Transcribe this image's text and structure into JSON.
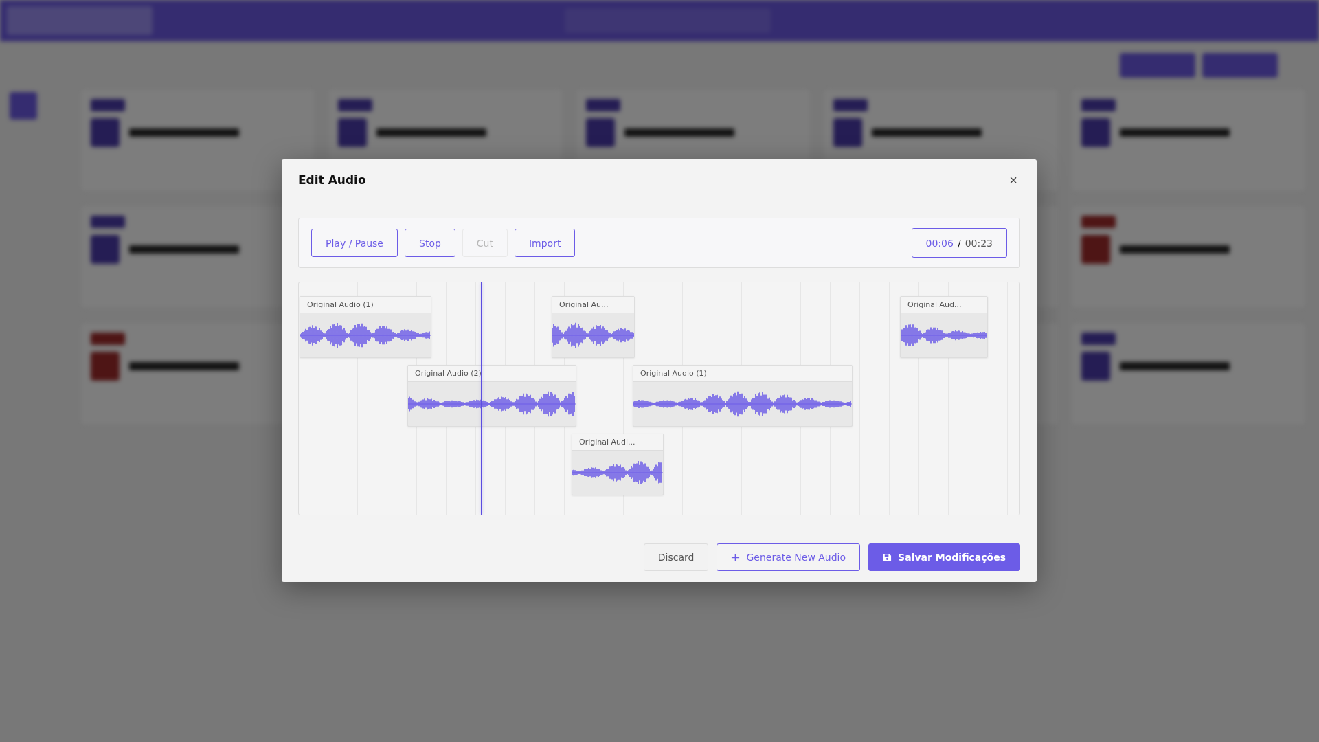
{
  "dialog": {
    "title": "Edit Audio",
    "close": "×",
    "toolbar": [
      {
        "label": "Play / Pause",
        "disabled": false
      },
      {
        "label": "Stop",
        "disabled": false
      },
      {
        "label": "Cut",
        "disabled": true
      },
      {
        "label": "Import",
        "disabled": false
      }
    ],
    "time": {
      "current": "00:06",
      "separator": "/",
      "total": "00:23"
    },
    "clips": [
      {
        "label": "Original Audio (1)"
      },
      {
        "label": "Original Au..."
      },
      {
        "label": "Original Aud..."
      },
      {
        "label": "Original Audio (2)"
      },
      {
        "label": "Original Audio (1)"
      },
      {
        "label": "Original Audi..."
      }
    ],
    "footer": [
      {
        "label": "Discard",
        "kind": "secondary"
      },
      {
        "label": "Generate New Audio",
        "kind": "outline"
      },
      {
        "label": "Salvar Modificações",
        "kind": "primary"
      }
    ]
  }
}
